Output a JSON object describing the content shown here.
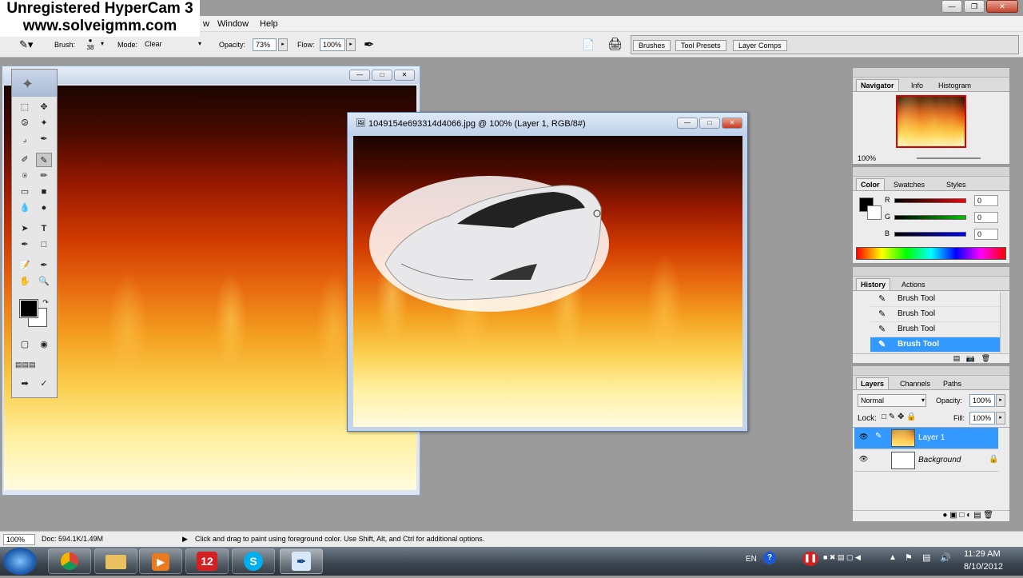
{
  "watermark": {
    "line1": "Unregistered HyperCam 3",
    "line2": "www.solveigmm.com"
  },
  "menu": {
    "items": [
      "w",
      "Window",
      "Help"
    ]
  },
  "options": {
    "brush_label": "Brush:",
    "brush_size": "38",
    "mode_label": "Mode:",
    "mode_value": "Clear",
    "opacity_label": "Opacity:",
    "opacity_value": "73%",
    "flow_label": "Flow:",
    "flow_value": "100%",
    "well_tabs": [
      "Brushes",
      "Tool Presets",
      "Layer Comps"
    ]
  },
  "doc2": {
    "title": "1049154e693314d4066.jpg @ 100% (Layer 1, RGB/8#)"
  },
  "toolbox": {
    "tools": [
      "marquee-tool",
      "move-tool",
      "lasso-tool",
      "magic-wand-tool",
      "crop-tool",
      "slice-tool",
      "healing-brush-tool",
      "brush-tool",
      "clone-stamp-tool",
      "history-brush-tool",
      "eraser-tool",
      "gradient-tool",
      "blur-tool",
      "dodge-tool",
      "path-selection-tool",
      "type-tool",
      "pen-tool",
      "rectangle-tool",
      "notes-tool",
      "eyedropper-tool",
      "hand-tool",
      "zoom-tool"
    ],
    "foreground": "#000000",
    "background": "#ffffff"
  },
  "navigator": {
    "tabs": [
      "Navigator",
      "Info",
      "Histogram"
    ],
    "zoom": "100%"
  },
  "color": {
    "tabs": [
      "Color",
      "Swatches",
      "Styles"
    ],
    "channels": [
      {
        "label": "R",
        "value": "0",
        "color": "#ff0000"
      },
      {
        "label": "G",
        "value": "0",
        "color": "#00c000"
      },
      {
        "label": "B",
        "value": "0",
        "color": "#0000ff"
      }
    ]
  },
  "history": {
    "tabs": [
      "History",
      "Actions"
    ],
    "items": [
      "Brush Tool",
      "Brush Tool",
      "Brush Tool",
      "Brush Tool"
    ]
  },
  "layers": {
    "tabs": [
      "Layers",
      "Channels",
      "Paths"
    ],
    "blend_mode": "Normal",
    "opacity_label": "Opacity:",
    "opacity_value": "100%",
    "lock_label": "Lock:",
    "fill_label": "Fill:",
    "fill_value": "100%",
    "items": [
      {
        "name": "Layer 1"
      },
      {
        "name": "Background"
      }
    ]
  },
  "status": {
    "zoom": "100%",
    "doc": "Doc: 594.1K/1.49M",
    "hint": "Click and drag to paint using foreground color.  Use Shift, Alt, and Ctrl for additional options."
  },
  "taskbar": {
    "apps": [
      "chrome",
      "explorer",
      "media-player",
      "12",
      "S",
      "photoshop"
    ],
    "lang": "EN",
    "time": "11:29 AM",
    "date": "8/10/2012"
  }
}
